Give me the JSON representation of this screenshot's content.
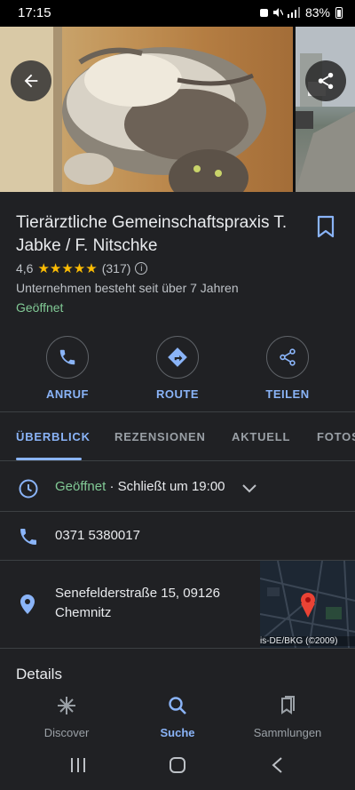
{
  "statusbar": {
    "time": "17:15",
    "battery": "83%"
  },
  "place": {
    "title": "Tierärztliche Gemeinschaftspraxis T. Jabke / F. Nitschke",
    "rating": "4,6",
    "stars": "★★★★★",
    "review_count": "(317)",
    "since": "Unternehmen besteht seit über 7 Jahren",
    "status": "Geöffnet"
  },
  "actions": [
    {
      "label": "ANRUF",
      "icon": "phone-icon"
    },
    {
      "label": "ROUTE",
      "icon": "directions-icon"
    },
    {
      "label": "TEILEN",
      "icon": "share-icon"
    }
  ],
  "tabs": [
    "ÜBERBLICK",
    "REZENSIONEN",
    "AKTUELL",
    "FOTOS"
  ],
  "hours": {
    "open": "Geöffnet",
    "closes": " · Schließt um 19:00"
  },
  "phone": "0371 5380017",
  "address": {
    "line1": "Senefelderstraße 15, 09126",
    "line2": "Chemnitz"
  },
  "map": {
    "attribution": "is-DE/BKG (©2009)"
  },
  "details_heading": "Details",
  "bottom_nav": [
    {
      "label": "Discover",
      "icon": "discover-icon"
    },
    {
      "label": "Suche",
      "icon": "search-icon"
    },
    {
      "label": "Sammlungen",
      "icon": "collections-icon"
    }
  ],
  "colors": {
    "accent": "#8ab4f8",
    "open_green": "#81c995",
    "star": "#fbbc04",
    "background": "#202124",
    "pin": "#ea4335"
  }
}
